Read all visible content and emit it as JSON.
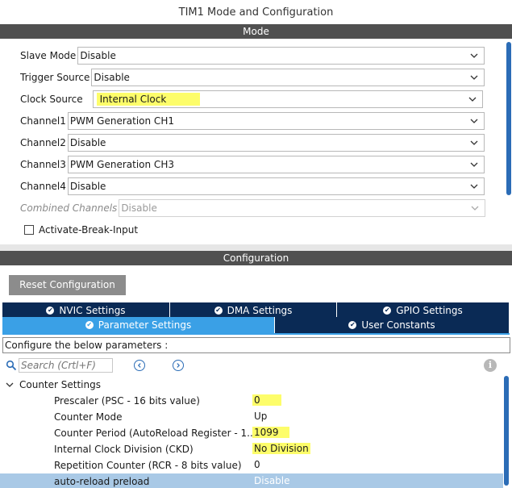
{
  "window": {
    "title": "TIM1 Mode and Configuration"
  },
  "mode": {
    "header": "Mode",
    "fields": [
      {
        "label": "Slave Mode",
        "value": "Disable"
      },
      {
        "label": "Trigger Source",
        "value": "Disable"
      },
      {
        "label": "Clock Source",
        "value": "Internal Clock",
        "highlighted": true
      },
      {
        "label": "Channel1",
        "value": "PWM Generation CH1"
      },
      {
        "label": "Channel2",
        "value": "Disable"
      },
      {
        "label": "Channel3",
        "value": "PWM Generation CH3"
      },
      {
        "label": "Channel4",
        "value": "Disable"
      },
      {
        "label": "Combined Channels",
        "value": "Disable",
        "disabled": true
      }
    ],
    "checkbox": {
      "label": "Activate-Break-Input",
      "checked": false
    }
  },
  "configuration": {
    "header": "Configuration",
    "reset_label": "Reset Configuration",
    "tabs_row1": [
      {
        "label": "NVIC Settings",
        "icon": "check-circle-icon"
      },
      {
        "label": "DMA Settings",
        "icon": "check-circle-icon"
      },
      {
        "label": "GPIO Settings",
        "icon": "check-circle-icon"
      }
    ],
    "tabs_row2": [
      {
        "label": "Parameter Settings",
        "icon": "check-circle-icon",
        "active": true
      },
      {
        "label": "User Constants",
        "icon": "check-circle-icon"
      }
    ],
    "instructions": "Configure the below parameters :",
    "search": {
      "placeholder": "Search (Crtl+F)"
    },
    "group": {
      "label": "Counter Settings",
      "expanded": true
    },
    "parameters": [
      {
        "name": "Prescaler (PSC - 16 bits value)",
        "value": "0",
        "highlighted": true
      },
      {
        "name": "Counter Mode",
        "value": "Up"
      },
      {
        "name": "Counter Period (AutoReload Register - 1...",
        "value": "1099",
        "highlighted": true
      },
      {
        "name": "Internal Clock Division (CKD)",
        "value": "No Division",
        "highlighted": true
      },
      {
        "name": "Repetition Counter (RCR - 8 bits value)",
        "value": "0"
      },
      {
        "name": "auto-reload preload",
        "value": "Disable",
        "selected": true
      }
    ]
  },
  "colors": {
    "section_bar": "#505050",
    "tab_dark": "#0a2a55",
    "tab_active": "#3aa0e6",
    "highlight": "#fdfd6a",
    "selected_row": "#a9c9e6"
  }
}
